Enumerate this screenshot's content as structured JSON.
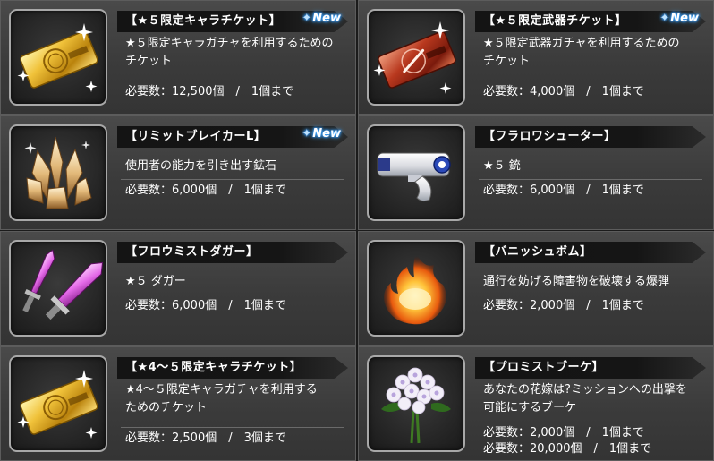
{
  "items": [
    {
      "title": "【★５限定キャラチケット】",
      "new": "New",
      "desc": "★５限定キャラガチャを利用するための\nチケット",
      "req": [
        "必要数：12,500個　/　1個まで"
      ],
      "icon": "gold-ticket-icon"
    },
    {
      "title": "【★５限定武器チケット】",
      "new": "New",
      "desc": "★５限定武器ガチャを利用するための\nチケット",
      "req": [
        "必要数：4,000個　/　1個まで"
      ],
      "icon": "red-weapon-ticket-icon"
    },
    {
      "title": "【リミットブレイカーL】",
      "new": "New",
      "desc": "使用者の能力を引き出す鉱石",
      "req": [
        "必要数：6,000個　/　1個まで"
      ],
      "icon": "crystal-ore-icon"
    },
    {
      "title": "【フラロワシューター】",
      "new": "",
      "desc": "★５ 銃",
      "req": [
        "必要数：6,000個　/　1個まで"
      ],
      "icon": "gun-icon"
    },
    {
      "title": "【フロウミストダガー】",
      "new": "",
      "desc": "★５ ダガー",
      "req": [
        "必要数：6,000個　/　1個まで"
      ],
      "icon": "twin-dagger-icon"
    },
    {
      "title": "【バニッシュボム】",
      "new": "",
      "desc": "通行を妨げる障害物を破壊する爆弾",
      "req": [
        "必要数：2,000個　/　1個まで"
      ],
      "icon": "fire-bomb-icon"
    },
    {
      "title": "【★4～５限定キャラチケット】",
      "new": "",
      "desc": "★4～５限定キャラガチャを利用する\nためのチケット",
      "req": [
        "必要数：2,500個　/　3個まで"
      ],
      "icon": "gold-ticket-icon"
    },
    {
      "title": "【プロミストブーケ】",
      "new": "",
      "desc": "あなたの花嫁は?ミッションへの出撃を\n可能にするブーケ",
      "req": [
        "必要数：2,000個　/　1個まで",
        "必要数：20,000個　/　1個まで"
      ],
      "icon": "bouquet-icon"
    }
  ]
}
